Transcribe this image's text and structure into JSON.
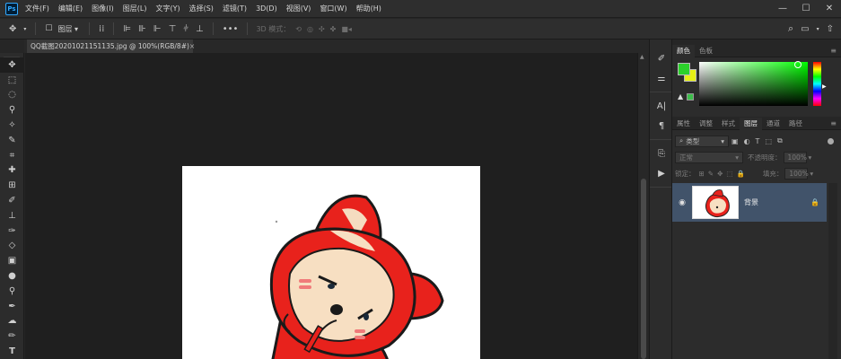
{
  "app": {
    "logo": "Ps",
    "menu": [
      "文件(F)",
      "编辑(E)",
      "图像(I)",
      "图层(L)",
      "文字(Y)",
      "选择(S)",
      "滤镜(T)",
      "3D(D)",
      "视图(V)",
      "窗口(W)",
      "帮助(H)"
    ],
    "window_controls": [
      "—",
      "☐",
      "✕"
    ]
  },
  "options": {
    "move_icon": "move-icon",
    "auto_select_label": "图层",
    "mode_3d_label": "3D 模式："
  },
  "document": {
    "tab_title": "QQ截图20201021151135.jpg @ 100%(RGB/8#)",
    "close": "×"
  },
  "panels": {
    "color": {
      "tabs": [
        "颜色",
        "色板"
      ],
      "foreground": "#2bd12b",
      "background": "#e6ef14",
      "gamut_swatch": "#3dbd4b"
    },
    "layers": {
      "tabs": [
        "属性",
        "调整",
        "样式",
        "图层",
        "通道",
        "路径"
      ],
      "filter_kind": "类型",
      "blend_mode": "正常",
      "opacity_label": "不透明度：",
      "opacity_value": "100%",
      "lock_label": "锁定：",
      "fill_label": "填充：",
      "fill_value": "100%",
      "layer_name": "背景"
    }
  }
}
